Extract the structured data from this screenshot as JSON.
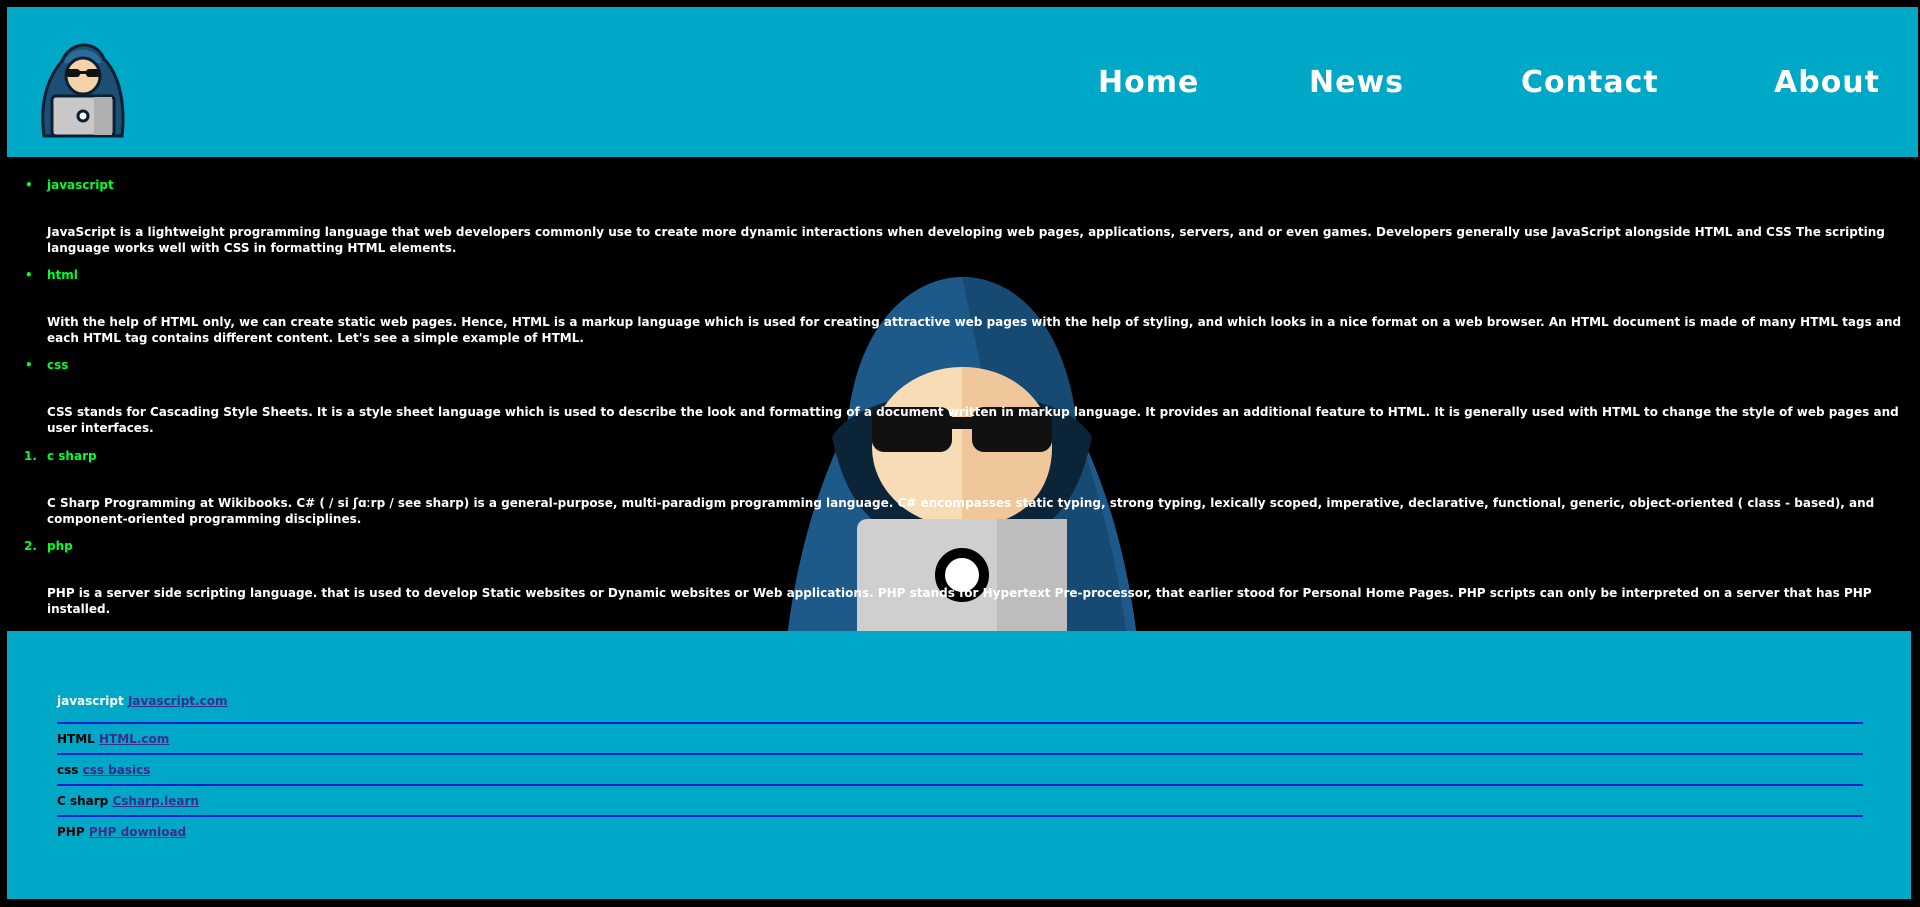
{
  "nav": {
    "items": [
      "Home",
      "News",
      "Contact",
      "About"
    ]
  },
  "topics": [
    {
      "marker": "•",
      "title": "javascript",
      "text": "JavaScript is a lightweight programming language that web developers commonly use to create more dynamic interactions when developing web pages, applications, servers, and or even games. Developers generally use JavaScript alongside HTML and CSS The scripting language works well with CSS in formatting HTML elements."
    },
    {
      "marker": "•",
      "title": "html",
      "text": "With the help of HTML only, we can create static web pages. Hence, HTML is a markup language which is used for creating attractive web pages with the help of styling, and which looks in a nice format on a web browser. An HTML document is made of many HTML tags and each HTML tag contains different content. Let's see a simple example of HTML."
    },
    {
      "marker": "•",
      "title": "css",
      "text": "CSS stands for Cascading Style Sheets. It is a style sheet language which is used to describe the look and formatting of a document written in markup language. It provides an additional feature to HTML. It is generally used with HTML to change the style of web pages and user interfaces."
    },
    {
      "marker": "1.",
      "title": "c sharp",
      "text": "C Sharp Programming at Wikibooks. C# ( / si ʃɑːrp / see sharp) is a general-purpose, multi-paradigm programming language. C# encompasses static typing, strong typing, lexically scoped, imperative, declarative, functional, generic, object-oriented ( class - based), and component-oriented programming disciplines."
    },
    {
      "marker": "2.",
      "title": "php",
      "text": "PHP is a server side scripting language. that is used to develop Static websites or Dynamic websites or Web applications. PHP stands for Hypertext Pre-processor, that earlier stood for Personal Home Pages. PHP scripts can only be interpreted on a server that has PHP installed."
    }
  ],
  "footer": {
    "links": [
      {
        "label": "javascript",
        "link": "Javascript.com",
        "label_color": "#ffffff"
      },
      {
        "label": "HTML",
        "link": "HTML.com",
        "label_color": "#000000"
      },
      {
        "label": "css",
        "link": "css basics",
        "label_color": "#000000"
      },
      {
        "label": "C sharp",
        "link": "Csharp.learn",
        "label_color": "#000000"
      },
      {
        "label": "PHP",
        "link": "PHP download",
        "label_color": "#000000"
      }
    ]
  },
  "colors": {
    "header_bg": "#00a8c8",
    "topic_title": "#00ff2a",
    "link": "#3a2e8a",
    "divider": "#0b1fd0"
  }
}
